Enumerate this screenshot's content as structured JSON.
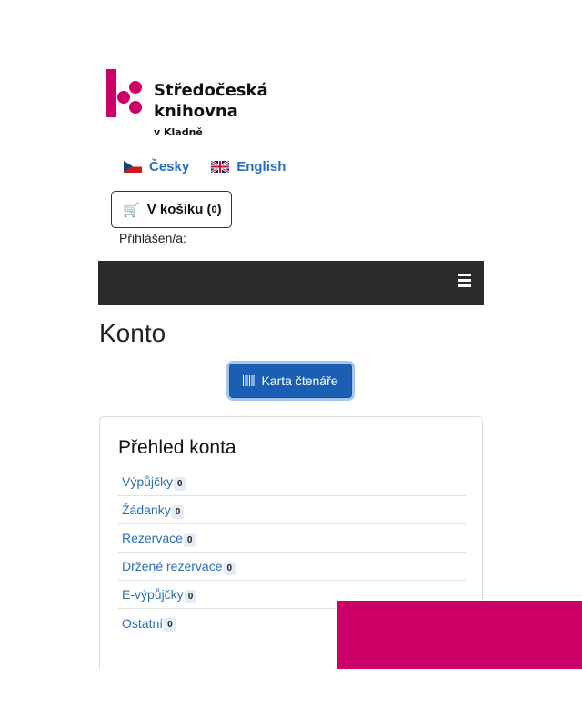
{
  "logo": {
    "name_line1": "Středočeská",
    "name_line2": "knihovna",
    "subtitle": "v Kladně"
  },
  "languages": [
    {
      "label": "Česky",
      "flag": "cz-flag-icon"
    },
    {
      "label": "English",
      "flag": "uk-flag-icon"
    }
  ],
  "cart": {
    "label": "V košíku (",
    "count": "0",
    "close": ")",
    "icon": "cart-icon"
  },
  "logged_in_label": "Přihlášen/a:",
  "navbar": {
    "menu_icon": "hamburger-icon"
  },
  "page_title": "Konto",
  "card_button": {
    "label": "Karta čtenáře",
    "icon": "barcode-icon"
  },
  "overview": {
    "title": "Přehled konta",
    "items": [
      {
        "label": "Výpůjčky",
        "count": "0"
      },
      {
        "label": "Žádanky",
        "count": "0"
      },
      {
        "label": "Rezervace",
        "count": "0"
      },
      {
        "label": "Držené rezervace",
        "count": "0"
      },
      {
        "label": "E-výpůjčky",
        "count": "0"
      },
      {
        "label": "Ostatní",
        "count": "0"
      }
    ]
  },
  "colors": {
    "brand_pink": "#cc0066",
    "link_blue": "#2a6fbd",
    "navbar_dark": "#2b2b2b",
    "button_blue": "#1a5fb4"
  }
}
